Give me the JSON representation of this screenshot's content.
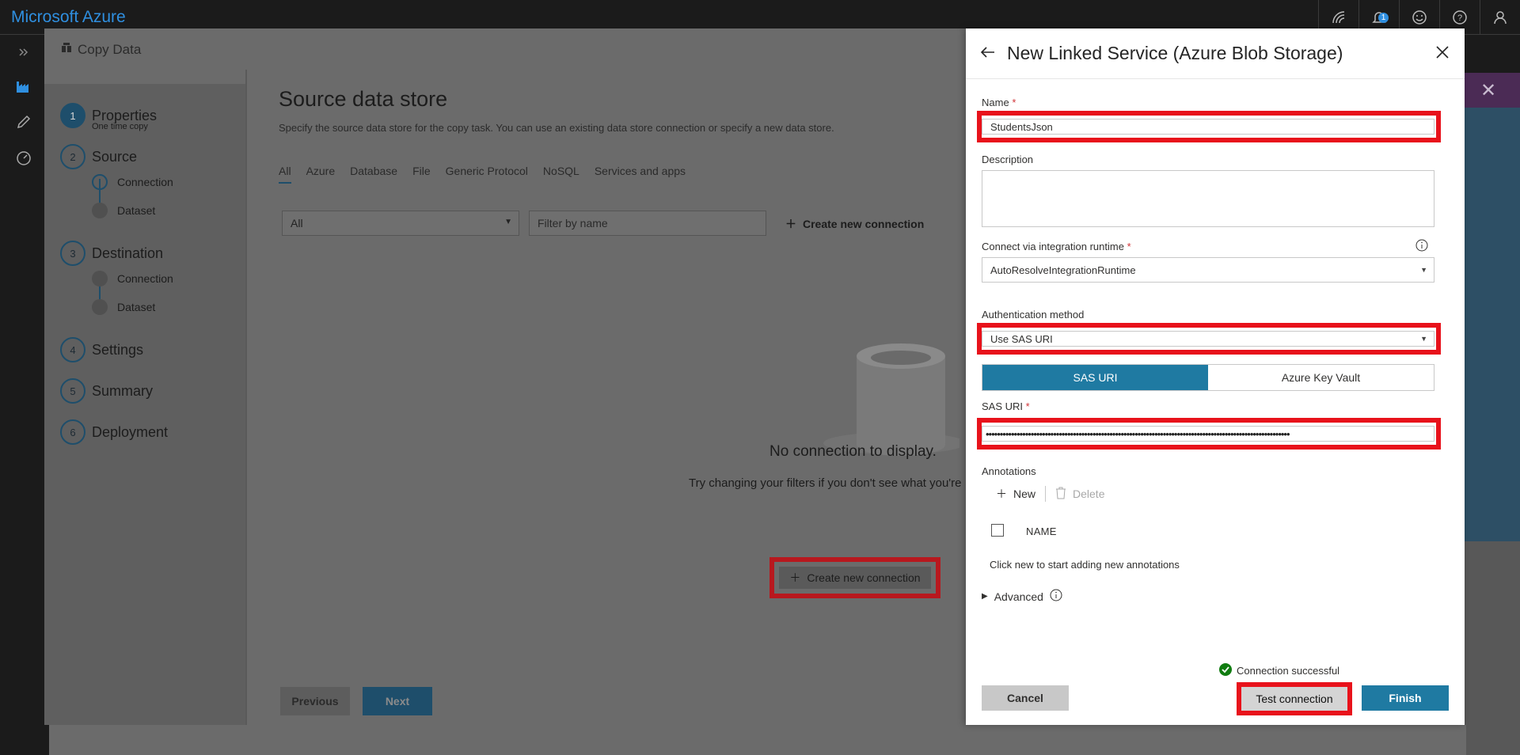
{
  "app": {
    "brand": "Microsoft Azure"
  },
  "topbar": {
    "notifications_count": "1"
  },
  "wizard": {
    "title": "Copy Data",
    "steps": [
      {
        "num": "1",
        "label": "Properties",
        "sub": "One time copy"
      },
      {
        "num": "2",
        "label": "Source"
      },
      {
        "num": "3",
        "label": "Destination"
      },
      {
        "num": "4",
        "label": "Settings"
      },
      {
        "num": "5",
        "label": "Summary"
      },
      {
        "num": "6",
        "label": "Deployment"
      }
    ],
    "source_substeps": [
      "Connection",
      "Dataset"
    ],
    "destination_substeps": [
      "Connection",
      "Dataset"
    ]
  },
  "main": {
    "title": "Source data store",
    "description": "Specify the source data store for the copy task. You can use an existing data store connection or specify a new data store.",
    "tabs": [
      "All",
      "Azure",
      "Database",
      "File",
      "Generic Protocol",
      "NoSQL",
      "Services and apps"
    ],
    "filter_select_value": "All",
    "filter_input_placeholder": "Filter by name",
    "create_new_connection": "Create new connection",
    "empty_title": "No connection to display.",
    "empty_hint": "Try changing your filters if you don't see what you're",
    "previous": "Previous",
    "next": "Next"
  },
  "dialog": {
    "title": "New Linked Service (Azure Blob Storage)",
    "name_label": "Name",
    "name_value": "StudentsJson",
    "description_label": "Description",
    "description_value": "",
    "runtime_label": "Connect via integration runtime",
    "runtime_value": "AutoResolveIntegrationRuntime",
    "auth_label": "Authentication method",
    "auth_value": "Use SAS URI",
    "seg_sas": "SAS URI",
    "seg_keyvault": "Azure Key Vault",
    "sas_label": "SAS URI",
    "sas_value": "••••••••••••••••••••••••••••••••••••••••••••••••••••••••••••••••••••••••••••••••••••••••••••••••••••••••••••",
    "required_mark": "*",
    "annotations_label": "Annotations",
    "ann_new": "New",
    "ann_delete": "Delete",
    "ann_col_name": "NAME",
    "ann_hint": "Click new to start adding new annotations",
    "advanced": "Advanced",
    "connection_status": "Connection successful",
    "cancel": "Cancel",
    "test_connection": "Test connection",
    "finish": "Finish"
  },
  "colors": {
    "accent": "#1f7aa2",
    "highlight_red": "#e8121b",
    "success_green": "#107c10"
  }
}
